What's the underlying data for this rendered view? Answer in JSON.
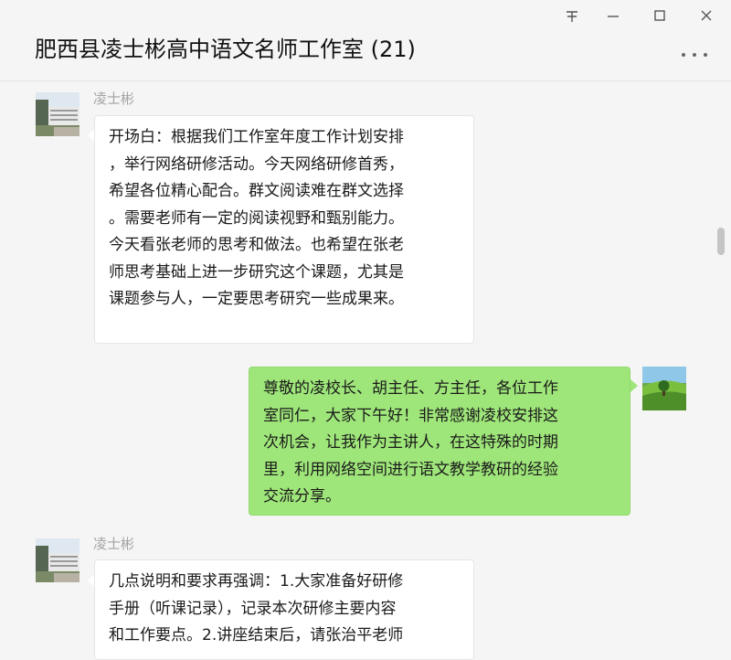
{
  "window": {
    "title": "肥西县凌士彬高中语文名师工作室 (21)",
    "pin_icon": "pin-icon",
    "minimize_icon": "minimize-icon",
    "maximize_icon": "maximize-icon",
    "close_icon": "close-icon",
    "more_icon": "more-dots-icon"
  },
  "colors": {
    "background": "#f5f5f5",
    "incoming_bubble": "#ffffff",
    "outgoing_bubble": "#9fe67a",
    "sender_name": "#a3a3a3"
  },
  "messages": [
    {
      "sender": "凌士彬",
      "direction": "incoming",
      "lines": [
        "开场白：根据我们工作室年度工作计划安排",
        "，举行网络研修活动。今天网络研修首秀，",
        "希望各位精心配合。群文阅读难在群文选择",
        "。需要老师有一定的阅读视野和甄别能力。",
        "今天看张老师的思考和做法。也希望在张老",
        "师思考基础上进一步研究这个课题，尤其是",
        "课题参与人，一定要思考研究一些成果来。"
      ]
    },
    {
      "direction": "outgoing",
      "lines": [
        "尊敬的凌校长、胡主任、方主任，各位工作",
        "室同仁，大家下午好！非常感谢凌校安排这",
        "次机会，让我作为主讲人，在这特殊的时期",
        "里，利用网络空间进行语文教学教研的经验",
        "交流分享。"
      ]
    },
    {
      "sender": "凌士彬",
      "direction": "incoming",
      "lines": [
        "几点说明和要求再强调：1.大家准备好研修",
        "手册（听课记录），记录本次研修主要内容",
        "和工作要点。2.讲座结束后，请张治平老师"
      ]
    }
  ]
}
